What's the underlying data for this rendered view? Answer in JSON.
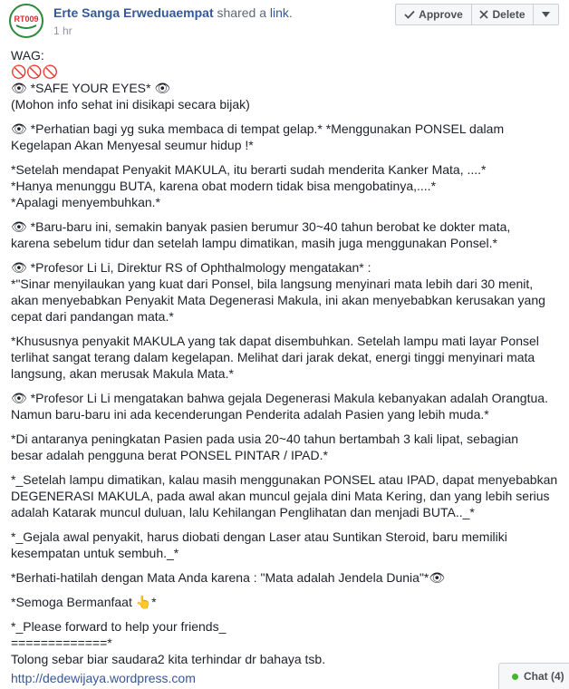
{
  "post": {
    "author": "Erte Sanga Erweduaempat",
    "shared_text": " shared a ",
    "link_word": "link",
    "link_period": ".",
    "time": "1 hr",
    "avatar_text": "RT009"
  },
  "actions": {
    "approve": "Approve",
    "delete": "Delete"
  },
  "paragraphs": [
    {
      "lines": [
        "WAG:",
        "🚫🚫🚫",
        "👁 *SAFE YOUR EYES* 👁",
        "(Mohon info sehat ini disikapi secara bijak)"
      ]
    },
    {
      "lines": [
        "👁 *Perhatian bagi yg suka membaca di tempat gelap.* *Menggunakan PONSEL dalam",
        "Kegelapan Akan Menyesal seumur hidup !*"
      ]
    },
    {
      "lines": [
        "*Setelah mendapat Penyakit MAKULA, itu berarti sudah menderita Kanker Mata, ....*",
        "*Hanya menunggu BUTA, karena obat modern tidak bisa mengobatinya,....*",
        "*Apalagi menyembuhkan.*"
      ]
    },
    {
      "lines": [
        "👁 *Baru-baru ini, semakin banyak pasien berumur 30~40 tahun berobat ke dokter mata,",
        "karena sebelum tidur dan setelah lampu dimatikan, masih juga menggunakan Ponsel.*"
      ]
    },
    {
      "lines": [
        "👁 *Profesor Li Li, Direktur RS of Ophthalmology mengatakan* :",
        "*\"Sinar menyilaukan yang kuat dari Ponsel, bila langsung menyinari mata lebih dari 30 menit,",
        "akan menyebabkan Penyakit Mata Degenerasi Makula, ini akan menyebabkan kerusakan yang",
        "cepat dari pandangan mata.*"
      ]
    },
    {
      "lines": [
        "*Khususnya penyakit MAKULA yang tak dapat disembuhkan. Setelah lampu mati layar Ponsel",
        "terlihat sangat terang dalam kegelapan. Melihat dari jarak dekat, energi tinggi menyinari mata",
        "langsung, akan merusak Makula Mata.*"
      ]
    },
    {
      "lines": [
        "👁 *Profesor Li Li mengatakan bahwa gejala Degenerasi Makula kebanyakan adalah Orangtua.",
        "Namun baru-baru ini ada kecenderungan Penderita adalah Pasien yang lebih muda.*"
      ]
    },
    {
      "lines": [
        "*Di antaranya peningkatan Pasien pada usia 20~40 tahun bertambah 3 kali lipat, sebagian",
        "besar adalah pengguna berat PONSEL PINTAR / IPAD.*"
      ]
    },
    {
      "lines": [
        "*_Setelah lampu dimatikan, kalau masih menggunakan PONSEL atau IPAD, dapat menyebabkan",
        "DEGENERASI MAKULA, pada awal akan muncul gejala dini Mata Kering, dan yang lebih serius",
        "adalah Katarak muncul duluan, lalu Kehilangan Penglihatan dan menjadi BUTA.._*"
      ]
    },
    {
      "lines": [
        "*_Gejala awal penyakit, harus diobati dengan Laser atau Suntikan Steroid, baru memiliki",
        "kesempatan untuk sembuh._*"
      ]
    },
    {
      "lines": [
        "*Berhati-hatilah dengan Mata Anda karena : \"Mata adalah Jendela Dunia\"*👁"
      ]
    },
    {
      "lines": [
        "*Semoga Bermanfaat 👆*"
      ]
    },
    {
      "lines": [
        "*_Please forward to help your friends_",
        "=============*",
        "Tolong sebar biar saudara2 kita terhindar dr bahaya tsb."
      ]
    }
  ],
  "link_url": "http://dedewijaya.wordpress.com",
  "chat": {
    "label": "Chat (4)",
    "status_color": "#42b72a"
  }
}
